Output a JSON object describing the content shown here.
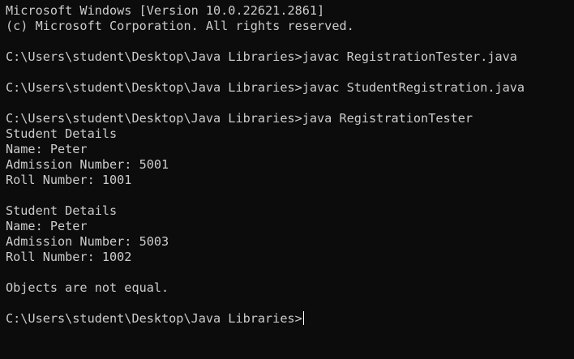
{
  "terminal": {
    "colors": {
      "background": "#0c0c0c",
      "foreground": "#cccccc",
      "cursor": "#ffffff"
    },
    "lines": [
      "Microsoft Windows [Version 10.0.22621.2861]",
      "(c) Microsoft Corporation. All rights reserved.",
      "",
      "C:\\Users\\student\\Desktop\\Java Libraries>javac RegistrationTester.java",
      "",
      "C:\\Users\\student\\Desktop\\Java Libraries>javac StudentRegistration.java",
      "",
      "C:\\Users\\student\\Desktop\\Java Libraries>java RegistrationTester",
      "Student Details",
      "Name: Peter",
      "Admission Number: 5001",
      "Roll Number: 1001",
      "",
      "Student Details",
      "Name: Peter",
      "Admission Number: 5003",
      "Roll Number: 1002",
      "",
      "Objects are not equal.",
      "",
      "C:\\Users\\student\\Desktop\\Java Libraries>"
    ]
  }
}
